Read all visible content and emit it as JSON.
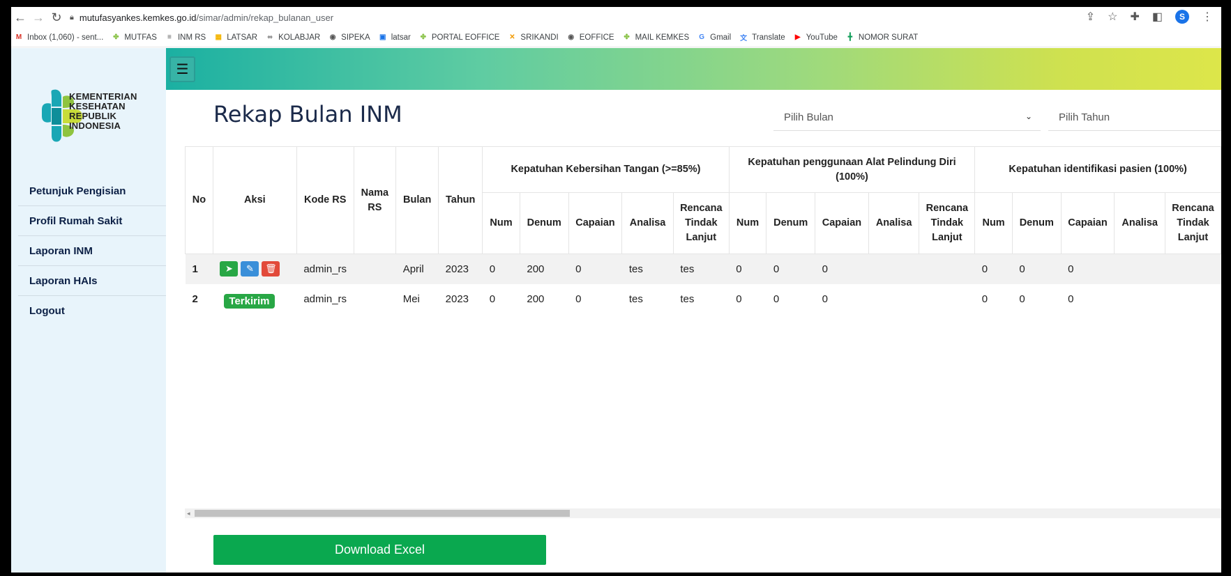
{
  "browser": {
    "url_host": "mutufasyankes.kemkes.go.id",
    "url_path": "/simar/admin/rekap_bulanan_user",
    "profile_initial": "S",
    "bookmarks": [
      {
        "icon": "gmail-icon",
        "label": "Inbox (1,060) - sent...",
        "color": "#d93025",
        "glyph": "M"
      },
      {
        "icon": "kemkes-icon",
        "label": "MUTFAS",
        "color": "#8bc34a",
        "glyph": "✤"
      },
      {
        "icon": "inm-icon",
        "label": "INM RS",
        "color": "#555555",
        "glyph": "≡"
      },
      {
        "icon": "latsar-icon",
        "label": "LATSAR",
        "color": "#f4b400",
        "glyph": "▦"
      },
      {
        "icon": "kolabjar-icon",
        "label": "KOLABJAR",
        "color": "#555555",
        "glyph": "∞"
      },
      {
        "icon": "globe-icon",
        "label": "SIPEKA",
        "color": "#555555",
        "glyph": "◉"
      },
      {
        "icon": "calendar-icon",
        "label": "latsar",
        "color": "#1a73e8",
        "glyph": "▣"
      },
      {
        "icon": "kemkes-icon",
        "label": "PORTAL EOFFICE",
        "color": "#8bc34a",
        "glyph": "✤"
      },
      {
        "icon": "srikandi-icon",
        "label": "SRIKANDI",
        "color": "#f29900",
        "glyph": "✕"
      },
      {
        "icon": "globe-icon",
        "label": "EOFFICE",
        "color": "#555555",
        "glyph": "◉"
      },
      {
        "icon": "kemkes-icon",
        "label": "MAIL KEMKES",
        "color": "#8bc34a",
        "glyph": "✤"
      },
      {
        "icon": "google-icon",
        "label": "Gmail",
        "color": "#4285f4",
        "glyph": "G"
      },
      {
        "icon": "translate-icon",
        "label": "Translate",
        "color": "#4285f4",
        "glyph": "文"
      },
      {
        "icon": "youtube-icon",
        "label": "YouTube",
        "color": "#ff0000",
        "glyph": "▶"
      },
      {
        "icon": "sheets-icon",
        "label": "NOMOR SURAT",
        "color": "#0f9d58",
        "glyph": "╋"
      }
    ]
  },
  "sidebar": {
    "logo_lines": [
      "KEMENTERIAN",
      "KESEHATAN",
      "REPUBLIK",
      "INDONESIA"
    ],
    "items": [
      {
        "label": "Petunjuk Pengisian"
      },
      {
        "label": "Profil Rumah Sakit"
      },
      {
        "label": "Laporan INM"
      },
      {
        "label": "Laporan HAIs"
      },
      {
        "label": "Logout"
      }
    ]
  },
  "header": {
    "menu_icon": "☰"
  },
  "main": {
    "title": "Rekap Bulan INM",
    "month_placeholder": "Pilih Bulan",
    "year_placeholder": "Pilih Tahun",
    "download_label": "Download Excel"
  },
  "table": {
    "base_headers": [
      "No",
      "Aksi",
      "Kode RS",
      "Nama RS",
      "Bulan",
      "Tahun"
    ],
    "groups": [
      "Kepatuhan Kebersihan Tangan (>=85%)",
      "Kepatuhan penggunaan Alat Pelindung Diri (100%)",
      "Kepatuhan identifikasi pasien (100%)"
    ],
    "sub_headers": [
      "Num",
      "Denum",
      "Capaian",
      "Analisa",
      "Rencana Tindak Lanjut"
    ],
    "rows": [
      {
        "no": "1",
        "status": "",
        "kode_rs": "admin_rs",
        "nama_rs": "",
        "bulan": "April",
        "tahun": "2023",
        "g1": [
          "0",
          "200",
          "0",
          "tes",
          "tes"
        ],
        "g2": [
          "0",
          "0",
          "0",
          "",
          ""
        ],
        "g3": [
          "0",
          "0",
          "0",
          "",
          ""
        ]
      },
      {
        "no": "2",
        "status": "Terkirim",
        "kode_rs": "admin_rs",
        "nama_rs": "",
        "bulan": "Mei",
        "tahun": "2023",
        "g1": [
          "0",
          "200",
          "0",
          "tes",
          "tes"
        ],
        "g2": [
          "0",
          "0",
          "0",
          "",
          ""
        ],
        "g3": [
          "0",
          "0",
          "0",
          "",
          ""
        ]
      }
    ]
  }
}
